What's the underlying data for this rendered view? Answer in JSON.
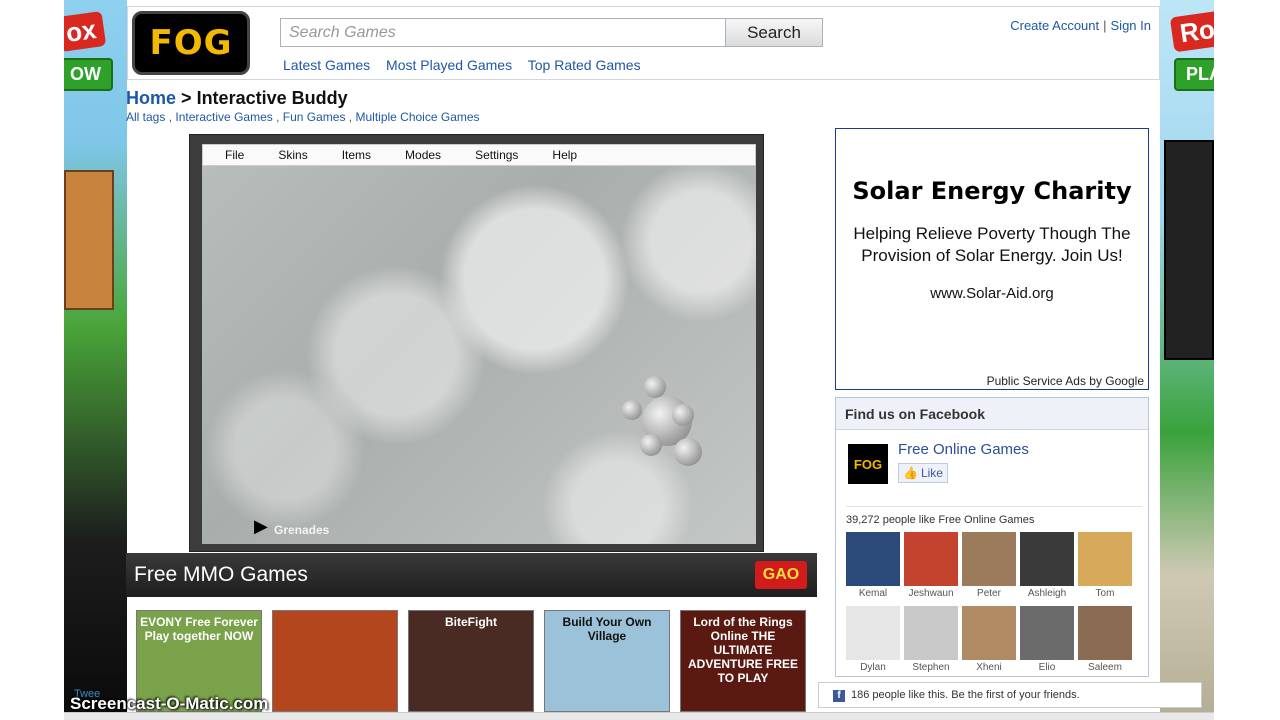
{
  "header": {
    "logo_text": "FOG",
    "search_placeholder": "Search Games",
    "search_button": "Search",
    "nav": [
      "Latest Games",
      "Most Played Games",
      "Top Rated Games"
    ],
    "create_account": "Create Account",
    "separator": "|",
    "sign_in": "Sign In"
  },
  "breadcrumb": {
    "home": "Home",
    "arrow": ">",
    "current": "Interactive Buddy"
  },
  "tags": {
    "items": [
      "All tags",
      "Interactive Games",
      "Fun Games",
      "Multiple Choice Games"
    ]
  },
  "game": {
    "menu": [
      "File",
      "Skins",
      "Items",
      "Modes",
      "Settings",
      "Help"
    ],
    "stage_label": "Grenades"
  },
  "mmo": {
    "title": "Free MMO Games",
    "badge": "GAO",
    "thumbs": [
      {
        "caption": "EVONY Free Forever Play together NOW",
        "color": "#7aa24a"
      },
      {
        "caption": "",
        "color": "#b3461c"
      },
      {
        "caption": "BiteFight",
        "color": "#4a2b24"
      },
      {
        "caption": "Build Your Own Village",
        "color": "#9bc2d8"
      },
      {
        "caption": "Lord of the Rings Online THE ULTIMATE ADVENTURE FREE TO PLAY",
        "color": "#5a1a12"
      }
    ]
  },
  "ad": {
    "title": "Solar Energy Charity",
    "body": "Helping Relieve Poverty Though The Provision of Solar Energy. Join Us!",
    "url": "www.Solar-Aid.org",
    "footer": "Public Service Ads by Google"
  },
  "facebook": {
    "header": "Find us on Facebook",
    "logo_text": "FOG",
    "page_name": "Free Online Games",
    "like_label": "Like",
    "count_text": "39,272 people like Free Online Games",
    "fans": [
      {
        "name": "Kemal",
        "color": "#2b4a7a"
      },
      {
        "name": "Jeshwaun",
        "color": "#c4432f"
      },
      {
        "name": "Peter",
        "color": "#9b7b5c"
      },
      {
        "name": "Ashleigh",
        "color": "#3a3a3a"
      },
      {
        "name": "Tom",
        "color": "#d7a95b"
      },
      {
        "name": "Dylan",
        "color": "#e6e6e6"
      },
      {
        "name": "Stephen",
        "color": "#c8c8c8"
      },
      {
        "name": "Xheni",
        "color": "#b08a63"
      },
      {
        "name": "Elio",
        "color": "#6b6b6b"
      },
      {
        "name": "Saleem",
        "color": "#8b6b52"
      }
    ],
    "bar_text": "186 people like this. Be the first of your friends."
  },
  "overlay": {
    "watermark": "Screencast-O-Matic.com",
    "tweet": "Twee"
  },
  "side": {
    "roblox_left": "ox",
    "play_left": "OW",
    "roblox_right": "Ro",
    "play_right": "PLA"
  }
}
